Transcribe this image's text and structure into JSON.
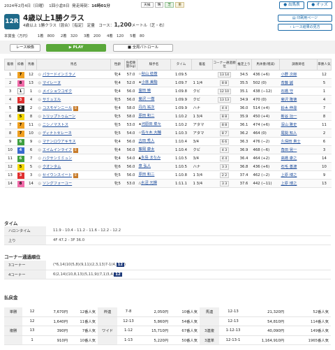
{
  "header": {
    "date_info": "2024年2月4日（日曜）",
    "meeting": "1回小倉8日",
    "post_time_label": "発走時刻：",
    "post_time": "16時01分",
    "tags": [
      "天候",
      "晴",
      "芝",
      "重"
    ],
    "entries_button": "出馬表",
    "odds_button": "オッズ"
  },
  "race": {
    "number": "12R",
    "title": "4歳以上1勝クラス",
    "conditions": "4歳以上 1勝クラス（混合）［指定］ 定量",
    "course_label": "コース：",
    "distance": "1,200",
    "distance_unit": "メートル（芝・右）",
    "print_button": "印刷用ページ",
    "views_button": "レース結果の見方"
  },
  "prize": {
    "label": "本賞金（万円）",
    "items": [
      "1着　800",
      "2着　320",
      "3着　200",
      "4着　120",
      "5着　80"
    ]
  },
  "video": {
    "label": "レース映像",
    "play": "▶ PLAY",
    "patrol": "全周パトロール"
  },
  "results": {
    "headers": [
      "着順",
      "枠番",
      "馬番",
      "馬名",
      "性齢",
      "負担重量(kg)",
      "騎手名",
      "タイム",
      "着差",
      "コーナー通過順位",
      "推定上り",
      "馬体重(増減)",
      "調教師名",
      "単勝人気"
    ],
    "rows": [
      {
        "pos": "1",
        "waku": "7",
        "wc": "#f0a020",
        "num": "12",
        "name": "パラードインミラノ",
        "blink": "",
        "sex": "牝4",
        "wt": "57.0",
        "jmark": "☆",
        "jockey": "秋山 稔樹",
        "time": "1:09.5",
        "margin": "",
        "corner": "13 14",
        "up": "34.5",
        "bw": "436 (+6)",
        "trainer": "小野 次郎",
        "pop": "12"
      },
      {
        "pos": "2",
        "waku": "8",
        "wc": "#f06aa8",
        "num": "13",
        "name": "マイレーヌ",
        "blink": "",
        "sex": "牝4",
        "wt": "52.0",
        "jmark": "★",
        "jockey": "小林 美駒",
        "time": "1:09.7",
        "margin": "1 1/4",
        "corner": "8 8",
        "up": "35.5",
        "bw": "502 (0)",
        "trainer": "斎藤 誠",
        "pop": "5"
      },
      {
        "pos": "3",
        "waku": "1",
        "wc": "#ffffff",
        "num": "1",
        "name": "メイショウコギク",
        "blink": "",
        "sex": "牝4",
        "wt": "56.0",
        "jmark": "",
        "jockey": "富田 暁",
        "time": "1:09.8",
        "margin": "クビ",
        "corner": "12 10",
        "up": "35.1",
        "bw": "438 (−12)",
        "trainer": "石橋 守",
        "pop": "1"
      },
      {
        "pos": "4",
        "waku": "3",
        "wc": "#e03030",
        "num": "4",
        "name": "サミュエル",
        "blink": "",
        "sex": "牝5",
        "wt": "56.0",
        "jmark": "",
        "jockey": "菊沢 一樹",
        "time": "1:09.9",
        "margin": "クビ",
        "corner": "13 13",
        "up": "34.9",
        "bw": "470 (0)",
        "trainer": "菊沢 隆徳",
        "pop": "4"
      },
      {
        "pos": "5",
        "waku": "2",
        "wc": "#222222",
        "num": "2",
        "name": "コスモゲンニール",
        "blink": "B",
        "sex": "牡4",
        "wt": "58.0",
        "jmark": "",
        "jockey": "丹内 祐次",
        "time": "1:09.9",
        "margin": "ハナ",
        "corner": "4 4",
        "up": "36.0",
        "bw": "514 (+4)",
        "trainer": "鈴木 伸尋",
        "pop": "7"
      },
      {
        "pos": "6",
        "waku": "5",
        "wc": "#f5d800",
        "num": "8",
        "name": "トリップトゥムーン",
        "blink": "",
        "sex": "牝5",
        "wt": "58.0",
        "jmark": "",
        "jockey": "原田 和二",
        "time": "1:10.2",
        "margin": "1 3/4",
        "corner": "8 8",
        "up": "35.9",
        "bw": "450 (+4)",
        "trainer": "新谷 功一",
        "pop": "8"
      },
      {
        "pos": "7",
        "waku": "7",
        "wc": "#f0a020",
        "num": "11",
        "name": "ニシノマストス",
        "blink": "",
        "sex": "牡5",
        "wt": "53.0",
        "jmark": "★",
        "jockey": "河原田 菜々",
        "time": "1:10.2",
        "margin": "アタマ",
        "corner": "8 8",
        "up": "36.1",
        "bw": "474 (+6)",
        "trainer": "深山 雅史",
        "pop": "11"
      },
      {
        "pos": "8",
        "waku": "7",
        "wc": "#f0a020",
        "num": "10",
        "name": "ディナトセレーネ",
        "blink": "",
        "sex": "牝5",
        "wt": "54.0",
        "jmark": "☆",
        "jockey": "佐々木 大輔",
        "time": "1:10.3",
        "margin": "アタマ",
        "corner": "8 7",
        "up": "36.2",
        "bw": "464 (0)",
        "trainer": "尾関 知人",
        "pop": "2"
      },
      {
        "pos": "9",
        "waku": "6",
        "wc": "#40a040",
        "num": "9",
        "name": "マテンロウアキモス",
        "blink": "",
        "sex": "牝4",
        "wt": "56.0",
        "jmark": "",
        "jockey": "古田 秀人",
        "time": "1:10.4",
        "margin": "3/4",
        "corner": "6 6",
        "up": "36.3",
        "bw": "476 (−2)",
        "trainer": "久保田 貴士",
        "pop": "6"
      },
      {
        "pos": "10",
        "waku": "4",
        "wc": "#3a6ad0",
        "num": "6",
        "name": "エイムインライフ",
        "blink": "B",
        "sex": "牝4",
        "wt": "56.0",
        "jmark": "",
        "jockey": "藤岡 康太",
        "time": "1:10.4",
        "margin": "クビ",
        "corner": "4 3",
        "up": "36.9",
        "bw": "468 (−6)",
        "trainer": "角田 晃一",
        "pop": "3"
      },
      {
        "pos": "11",
        "waku": "6",
        "wc": "#40a040",
        "num": "7",
        "name": "ハクサンミミュン",
        "blink": "",
        "sex": "牝4",
        "wt": "54.0",
        "jmark": "▲",
        "jockey": "永島 まなみ",
        "time": "1:10.5",
        "margin": "3/4",
        "corner": "4 4",
        "up": "36.4",
        "bw": "464 (+2)",
        "trainer": "高橋 康之",
        "pop": "14"
      },
      {
        "pos": "12",
        "waku": "5",
        "wc": "#f5d800",
        "num": "5",
        "name": "クオンタム",
        "blink": "",
        "sex": "牡6",
        "wt": "56.0",
        "jmark": "",
        "jockey": "泉 弘人",
        "time": "1:10.5",
        "margin": "ハナ",
        "corner": "3 3",
        "up": "36.8",
        "bw": "436 (+6)",
        "trainer": "石毛 善渡",
        "pop": "10"
      },
      {
        "pos": "13",
        "waku": "3",
        "wc": "#e03030",
        "num": "3",
        "name": "セイウンスイート",
        "blink": "B",
        "sex": "牝5",
        "wt": "56.0",
        "jmark": "",
        "jockey": "原田 和二",
        "time": "1:10.8",
        "margin": "1 3/4",
        "corner": "2 2",
        "up": "37.4",
        "bw": "462 (−2)",
        "trainer": "上原 博之",
        "pop": "9"
      },
      {
        "pos": "14",
        "waku": "8",
        "wc": "#f06aa8",
        "num": "14",
        "name": "ソングフォーユー",
        "blink": "",
        "sex": "牝5",
        "wt": "53.0",
        "jmark": "△",
        "jockey": "水沼 元輝",
        "time": "1:11.1",
        "margin": "1 3/4",
        "corner": "3 3",
        "up": "37.6",
        "bw": "442 (−11)",
        "trainer": "上原 博之",
        "pop": "13"
      }
    ]
  },
  "time_section": {
    "title": "タイム",
    "halon_label": "ハロンタイム",
    "halon": "11.9 - 10.4 - 11.2 - 11.6 - 12.2 - 12.2",
    "agari_label": "上り",
    "agari": "4F 47.2 - 3F 36.0"
  },
  "corner_section": {
    "title": "コーナー通過順位",
    "c3_label": "3コーナー",
    "c3": "(*6,14)10(5,8)(9,11)(2,3,13)7-1(4,",
    "c3_last": "12",
    "c3_tail": ")",
    "c4_label": "4コーナー",
    "c4": "6(2,14)(10,8,13)(5,11,9)(7,1)3,4,",
    "c4_last": "12"
  },
  "payout": {
    "title": "払戻金",
    "rows": [
      [
        "単勝",
        "12",
        "7,670円",
        "12番人気",
        "枠連",
        "7-8",
        "2,050円",
        "10番人気",
        "馬連",
        "12-13",
        "21,320円",
        "52番人気"
      ],
      [
        "",
        "12",
        "1,640円",
        "11番人気",
        "",
        "12-13",
        "5,860円",
        "54番人気",
        "",
        "12-13",
        "54,810円",
        "114番人気"
      ],
      [
        "複勝",
        "13",
        "390円",
        "7番人気",
        "ワイド",
        "1-12",
        "15,710円",
        "67番人気",
        "3連複",
        "1-12-13",
        "40,090円",
        "149番人気"
      ],
      [
        "",
        "1",
        "910円",
        "10番人気",
        "",
        "1-13",
        "5,220円",
        "50番人気",
        "3連単",
        "12-13-1",
        "1,164,910円",
        "1965番人気"
      ]
    ]
  }
}
